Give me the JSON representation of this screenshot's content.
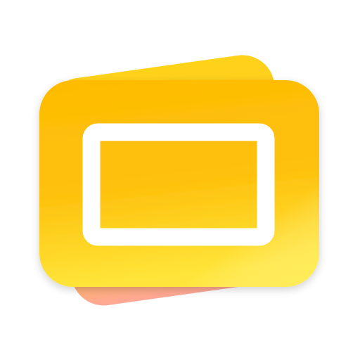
{
  "icon": {
    "name": "slides-app-icon",
    "colors": {
      "front_card_top": "#FEBC03",
      "front_card_bottom": "#FFE53A",
      "back_card_top": "#FFD21A",
      "back_card_bottom": "#FFA796",
      "frame": "#FFFFFF"
    }
  }
}
